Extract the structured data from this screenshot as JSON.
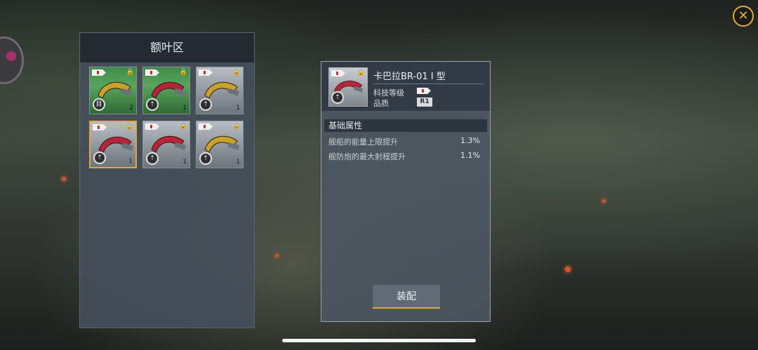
{
  "panel_left": {
    "title": "额叶区",
    "items": [
      {
        "color": "green",
        "part_color": "#c9a22a",
        "badge": "目",
        "count": "2",
        "selected": false
      },
      {
        "color": "green",
        "part_color": "#b8243a",
        "badge": "⇡",
        "count": "1",
        "selected": false
      },
      {
        "color": "gray",
        "part_color": "#c9a22a",
        "badge": "⇡",
        "count": "1",
        "selected": false
      },
      {
        "color": "gray",
        "part_color": "#b8243a",
        "badge": "⇡",
        "count": "1",
        "selected": true
      },
      {
        "color": "gray",
        "part_color": "#b8243a",
        "badge": "⇡",
        "count": "1",
        "selected": false
      },
      {
        "color": "gray",
        "part_color": "#c9a22a",
        "badge": "⇡",
        "count": "1",
        "selected": false
      }
    ]
  },
  "detail": {
    "name": "卡巴拉BR-01 I 型",
    "tech_level_label": "科技等级",
    "quality_label": "品质",
    "quality_value": "R1",
    "section_title": "基础属性",
    "attributes": [
      {
        "name": "舰船的能量上限提升",
        "value": "1.3%"
      },
      {
        "name": "舰防炮的最大射程提升",
        "value": "1.1%"
      }
    ],
    "equip_label": "装配"
  },
  "close_glyph": "✕",
  "colors": {
    "accent": "#e2a83a",
    "red_part": "#b8243a",
    "gold_part": "#c9a22a"
  }
}
